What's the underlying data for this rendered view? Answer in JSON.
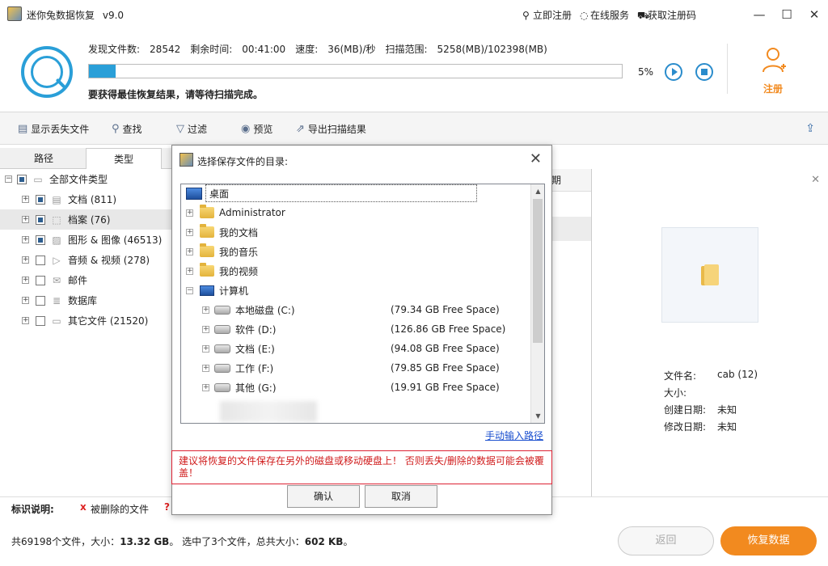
{
  "titlebar": {
    "title": "迷你兔数据恢复",
    "version": "v9.0",
    "links": [
      {
        "icon": "key-icon",
        "glyph": "⚲",
        "label": "立即注册"
      },
      {
        "icon": "headset-icon",
        "glyph": "◌",
        "label": "在线服务"
      },
      {
        "icon": "cart-icon",
        "glyph": "⛟",
        "label": "获取注册码"
      }
    ],
    "window_buttons": [
      "—",
      "☐",
      "✕"
    ]
  },
  "scan": {
    "found_label": "发现文件数:",
    "found_value": "28542",
    "remaining_label": "剩余时间:",
    "remaining_value": "00:41:00",
    "speed_label": "速度:",
    "speed_value": "36(MB)/秒",
    "range_label": "扫描范围:",
    "range_value": "5258(MB)/102398(MB)",
    "progress_percent": 5,
    "progress_text": "5%",
    "hint": "要获得最佳恢复结果，请等待扫描完成。",
    "register_label": "注册",
    "accent": "#2a9fd8",
    "orange": "#f28a1f"
  },
  "toolbar": {
    "show_lost": "显示丢失文件",
    "find": "查找",
    "filter": "过滤",
    "preview": "预览",
    "export": "导出扫描结果"
  },
  "left": {
    "tabs": [
      "路径",
      "类型"
    ],
    "root": "全部文件类型",
    "items": [
      {
        "label": "文档 (811)",
        "icon": "document-icon",
        "glyph": "▤",
        "checked": "part"
      },
      {
        "label": "档案 (76)",
        "icon": "archive-icon",
        "glyph": "⬚",
        "checked": "part"
      },
      {
        "label": "图形 & 图像 (46513)",
        "icon": "image-icon",
        "glyph": "▨",
        "checked": "part"
      },
      {
        "label": "音频 & 视频 (278)",
        "icon": "media-icon",
        "glyph": "▷",
        "checked": "none"
      },
      {
        "label": "邮件",
        "icon": "mail-icon",
        "glyph": "✉",
        "checked": "none"
      },
      {
        "label": "数据库",
        "icon": "database-icon",
        "glyph": "≣",
        "checked": "none"
      },
      {
        "label": "其它文件 (21520)",
        "icon": "folder-icon",
        "glyph": "▭",
        "checked": "none"
      }
    ]
  },
  "middle": {
    "column_fragment": "期"
  },
  "preview": {
    "name_label": "文件名:",
    "name_value": "cab (12)",
    "size_label": "大小:",
    "created_label": "创建日期:",
    "created_value": "未知",
    "modified_label": "修改日期:",
    "modified_value": "未知"
  },
  "legend": {
    "title": "标识说明:",
    "deleted_mark": "x",
    "deleted_label": "被删除的文件",
    "unknown_mark": "?"
  },
  "status": {
    "summary": "共69198个文件，大小：",
    "total_size": "13.32 GB",
    "selected": "。 选中了3个文件，总共大小：",
    "selected_size": "602 KB",
    "end": "。",
    "back": "返回",
    "recover": "恢复数据"
  },
  "dialog": {
    "title": "选择保存文件的目录:",
    "desktop": "桌面",
    "user_folders": [
      "Administrator",
      "我的文档",
      "我的音乐",
      "我的视频"
    ],
    "computer": "计算机",
    "drives": [
      {
        "label": "本地磁盘 (C:)",
        "free": "(79.34 GB Free Space)"
      },
      {
        "label": "软件 (D:)",
        "free": "(126.86 GB Free Space)"
      },
      {
        "label": "文档 (E:)",
        "free": "(94.08 GB Free Space)"
      },
      {
        "label": "工作 (F:)",
        "free": "(79.85 GB Free Space)"
      },
      {
        "label": "其他 (G:)",
        "free": "(19.91 GB Free Space)"
      }
    ],
    "manual_link": "手动输入路径",
    "warning": "建议将恢复的文件保存在另外的磁盘或移动硬盘上！ 否则丢失/删除的数据可能会被覆盖！",
    "ok": "确认",
    "cancel": "取消"
  }
}
